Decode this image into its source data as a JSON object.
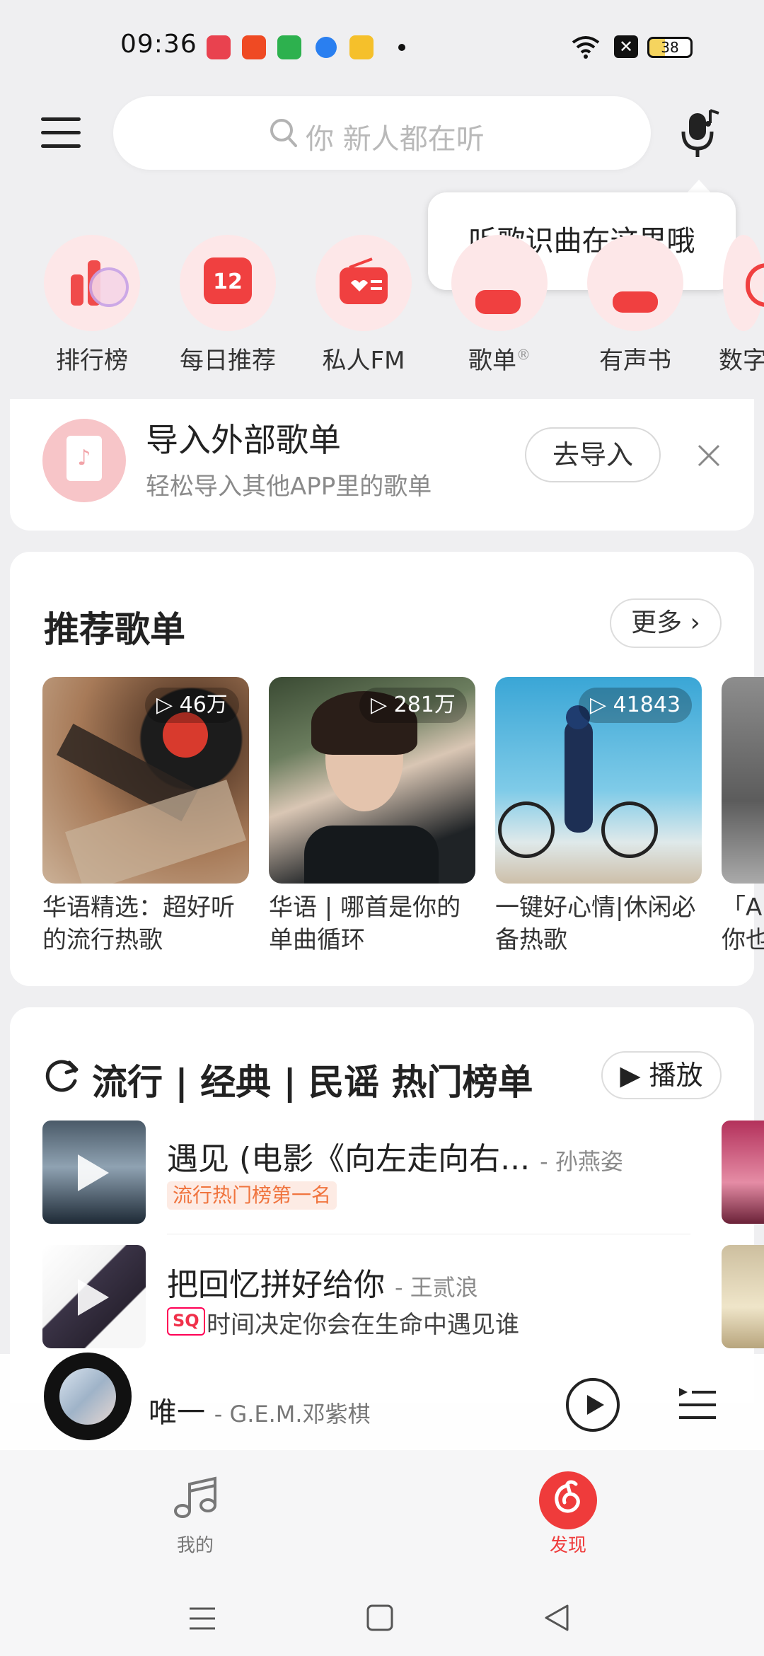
{
  "status_bar": {
    "time": "09:36",
    "battery": "38"
  },
  "header": {
    "search_placeholder": "你 新人都在听",
    "tooltip": "听歌识曲在这里哦"
  },
  "quick_nav": [
    {
      "label": "排行榜",
      "icon": "chart-icon"
    },
    {
      "label": "每日推荐",
      "icon": "calendar-icon",
      "badge": "12"
    },
    {
      "label": "私人FM",
      "icon": "radio-icon"
    },
    {
      "label": "歌单",
      "icon": "playlist-icon",
      "mark": "®"
    },
    {
      "label": "有声书",
      "icon": "book-icon"
    },
    {
      "label": "数字",
      "icon": "album-icon"
    }
  ],
  "import_card": {
    "title": "导入外部歌单",
    "subtitle": "轻松导入其他APP里的歌单",
    "button": "去导入"
  },
  "recommended": {
    "title": "推荐歌单",
    "more": "更多",
    "playlists": [
      {
        "count": "46万",
        "title_line1": "华语精选：超好听",
        "title_line2": "的流行热歌"
      },
      {
        "count": "281万",
        "title_line1": "华语 | 哪首是你的",
        "title_line2": "单曲循环"
      },
      {
        "count": "41843",
        "title_line1": "一键好心情|休闲必",
        "title_line2": "备热歌"
      },
      {
        "count": "",
        "title_line1": "「A",
        "title_line2": "你也"
      }
    ]
  },
  "charts_section": {
    "title": "流行 | 经典 | 民谣 热门榜单",
    "play": "播放",
    "songs": [
      {
        "title": "遇见 (电影《向左走向右...",
        "artist": "- 孙燕姿",
        "tag": "流行热门榜第一名"
      },
      {
        "title": "把回忆拼好给你",
        "artist": "- 王贰浪",
        "quality": "SQ",
        "subtitle": "时间决定你会在生命中遇见谁"
      }
    ]
  },
  "now_playing": {
    "title": "唯一",
    "artist": "- G.E.M.邓紫棋"
  },
  "tabs": [
    {
      "label": "我的",
      "active": false
    },
    {
      "label": "发现",
      "active": true
    }
  ],
  "colors": {
    "accent": "#ef3b3b",
    "bg": "#efeff1"
  }
}
